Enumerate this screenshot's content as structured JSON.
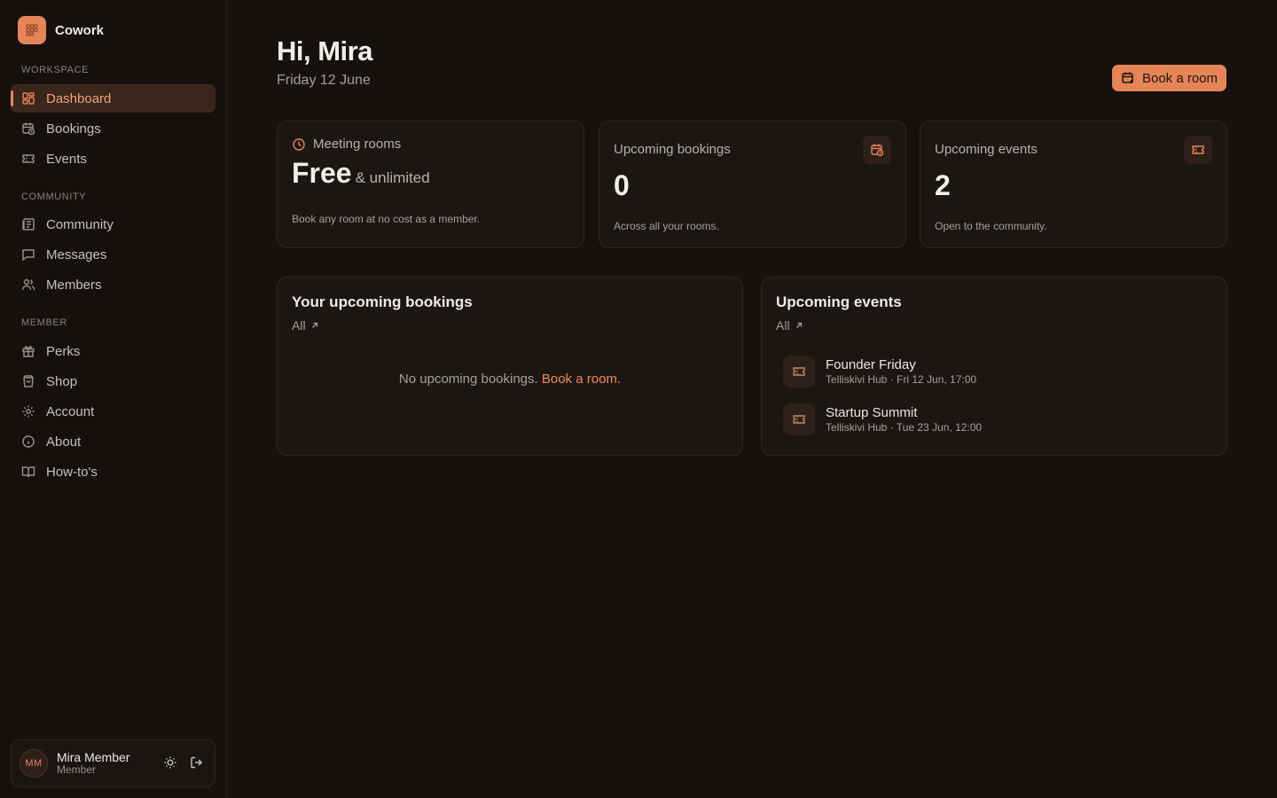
{
  "brand": {
    "name": "Cowork"
  },
  "sidebar": {
    "sections": {
      "workspace": "WORKSPACE",
      "community": "COMMUNITY",
      "member": "MEMBER"
    },
    "items": {
      "dashboard": "Dashboard",
      "bookings": "Bookings",
      "events": "Events",
      "community": "Community",
      "messages": "Messages",
      "members": "Members",
      "perks": "Perks",
      "shop": "Shop",
      "account": "Account",
      "about": "About",
      "howtos": "How-to's"
    },
    "active": "dashboard"
  },
  "user": {
    "initials": "MM",
    "name": "Mira Member",
    "role": "Member"
  },
  "header": {
    "greeting": "Hi, Mira",
    "date": "Friday 12 June",
    "book_button": "Book a room"
  },
  "stats": {
    "meeting_rooms": {
      "label": "Meeting rooms",
      "value": "Free",
      "value_suffix": "& unlimited",
      "sub": "Book any room at no cost as a member."
    },
    "upcoming_bookings": {
      "label": "Upcoming bookings",
      "value": "0",
      "sub": "Across all your rooms."
    },
    "upcoming_events": {
      "label": "Upcoming events",
      "value": "2",
      "sub": "Open to the community."
    }
  },
  "bookings_panel": {
    "title": "Your upcoming bookings",
    "all_label": "All",
    "empty_text": "No upcoming bookings.",
    "empty_link": "Book a room."
  },
  "events_panel": {
    "title": "Upcoming events",
    "all_label": "All",
    "events": [
      {
        "name": "Founder Friday",
        "meta": "Telliskivi Hub · Fri 12 Jun, 17:00"
      },
      {
        "name": "Startup Summit",
        "meta": "Telliskivi Hub · Tue 23 Jun, 12:00"
      }
    ]
  },
  "colors": {
    "accent": "#e58557",
    "background": "#16110e",
    "card": "#1c1612"
  }
}
